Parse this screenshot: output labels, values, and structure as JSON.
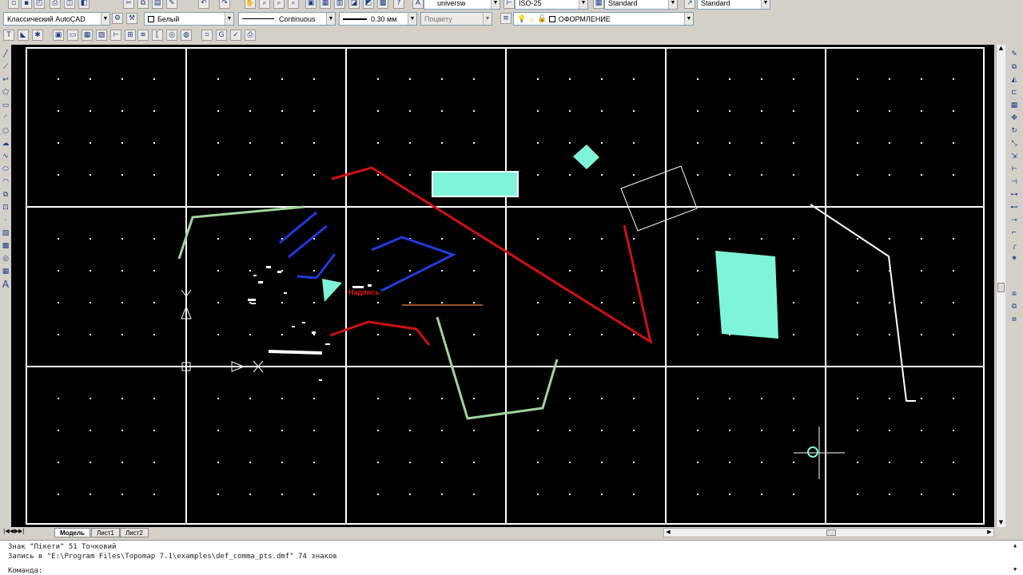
{
  "toolbar_top": {
    "text_style": "universw",
    "dim_style": "ISO-25",
    "table_style": "Standard",
    "multileader_style": "Standard"
  },
  "toolbar_props": {
    "workspace": "Классический AutoCAD",
    "layer_color": "Белый",
    "linetype": "Continuous",
    "lineweight": "0.30 мм",
    "plotstyle": "Поцвету",
    "layer_name": "ОФОРМЛЕНИЕ"
  },
  "toolbar_third": {
    "icons": [
      "text-format-icon",
      "fill-icon",
      "snowflake-icon",
      "image-icon",
      "rectangle-icon",
      "grid-icon",
      "hatch-icon",
      "dimension-icon",
      "table-icon",
      "wave-icon",
      "bracket-icon",
      "orbit-icon",
      "globe-icon",
      "label-icon",
      "gbd-icon",
      "check-icon",
      "print-icon"
    ]
  },
  "canvas": {
    "label_text": "Надпись"
  },
  "tabs": {
    "model": "Модель",
    "sheet1": "Лист1",
    "sheet2": "Лист2"
  },
  "command_line": {
    "line1": "Знак \"Пікети\" 51 Точковий",
    "line2": "Запись в \"E:\\Program Files\\Topomap 7.1\\examples\\def_comma_pts.dmf\" 74 знаков",
    "prompt": "Команда:"
  },
  "colors": {
    "canvas_bg": "#000000",
    "grid_line": "#ffffff",
    "cyan_fill": "#7ef5d8",
    "red_line": "#d01010",
    "blue_line": "#1f3be0",
    "green_line": "#9ed69a",
    "chrome_bg": "#d4d0c8"
  }
}
